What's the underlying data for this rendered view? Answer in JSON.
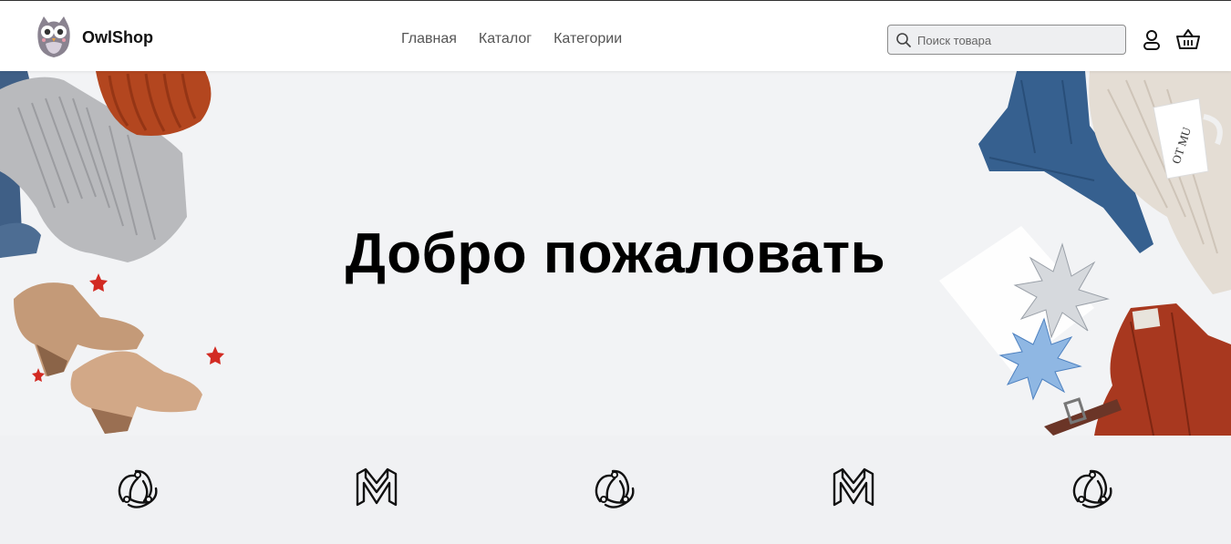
{
  "header": {
    "brand_name": "OwlShop",
    "logo_icon": "owl-logo-icon",
    "nav": [
      {
        "label": "Главная"
      },
      {
        "label": "Каталог"
      },
      {
        "label": "Категории"
      }
    ],
    "search": {
      "placeholder": "Поиск товара",
      "value": "",
      "icon": "search-icon"
    },
    "user_icon": "user-icon",
    "cart_icon": "basket-icon"
  },
  "hero": {
    "title": "Добро пожаловать",
    "left_image": "clothing-and-boots-photo",
    "right_image": "jeans-sweater-mug-photo"
  },
  "brands": [
    {
      "icon": "redux-logo-icon"
    },
    {
      "icon": "m-logo-icon"
    },
    {
      "icon": "redux-logo-icon"
    },
    {
      "icon": "m-logo-icon"
    },
    {
      "icon": "redux-logo-icon"
    }
  ],
  "colors": {
    "background": "#f2f3f5",
    "header": "#ffffff",
    "text": "#000000",
    "nav_text": "#555555"
  }
}
